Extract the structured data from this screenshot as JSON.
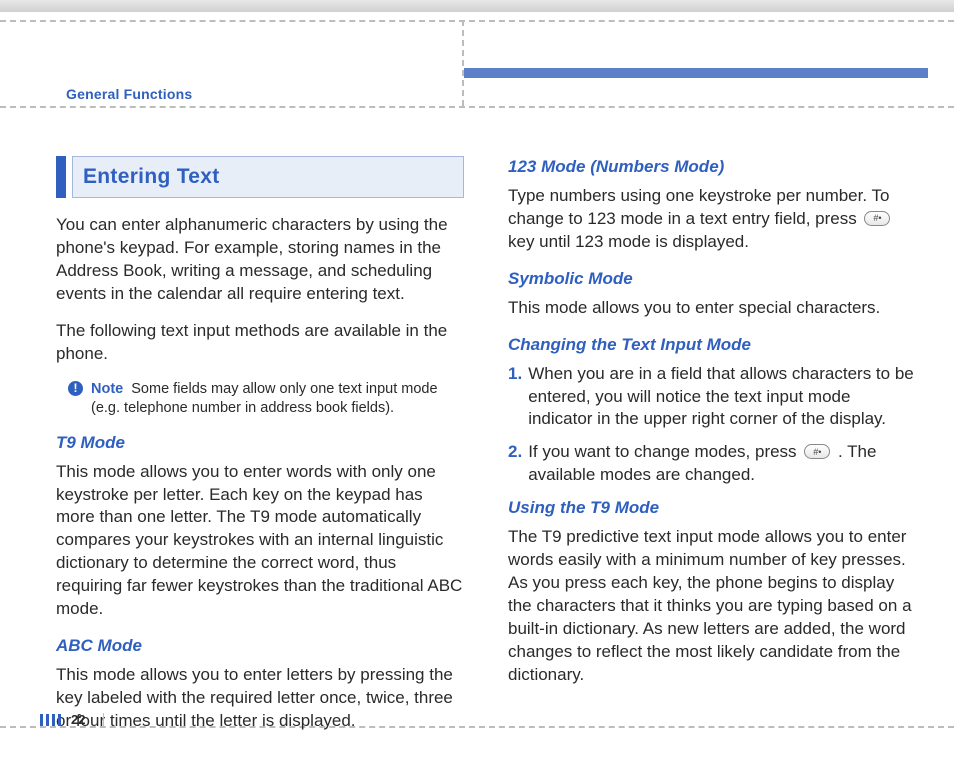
{
  "header": {
    "section_label": "General Functions"
  },
  "page": {
    "number": "22"
  },
  "left": {
    "heading": "Entering Text",
    "intro_p1": "You can enter alphanumeric characters by using the phone's keypad. For example, storing names in the Address Book, writing a message, and scheduling events in the calendar all require entering text.",
    "intro_p2": "The following text input methods are available in the phone.",
    "note_label": "Note",
    "note_text": "Some fields may allow only one text input mode (e.g. telephone number in address book fields).",
    "t9_title": "T9 Mode",
    "t9_body": "This mode allows you to enter words with only one keystroke per letter. Each key on the keypad has more than one letter. The T9 mode automatically compares your keystrokes with an internal linguistic dictionary to determine the correct word, thus requiring far fewer keystrokes than the traditional ABC mode.",
    "abc_title": "ABC Mode",
    "abc_body": "This mode allows you to enter letters by pressing the key labeled with the required letter once, twice, three or four times until the letter is displayed."
  },
  "right": {
    "m123_title": "123 Mode (Numbers Mode)",
    "m123_body_a": "Type numbers using one keystroke per number. To change to 123 mode in a text entry field, press ",
    "m123_body_b": " key until 123 mode is displayed.",
    "sym_title": "Symbolic Mode",
    "sym_body": "This mode allows you to enter special characters.",
    "chg_title": "Changing the Text Input Mode",
    "chg_item1_num": "1.",
    "chg_item1": "When you are in a field that allows characters to be entered, you will notice the text input mode indicator in the upper right corner of the display.",
    "chg_item2_num": "2.",
    "chg_item2_a": "If you want to change modes, press ",
    "chg_item2_b": " . The available modes are changed.",
    "use_title": "Using the T9 Mode",
    "use_body": "The T9 predictive text input mode allows you to enter words easily with a minimum number of key presses. As you press each key, the phone begins to display the characters that it thinks you are typing based on a built-in dictionary. As new letters are added, the word changes to reflect the most likely candidate from the dictionary.",
    "key_glyph": "#•"
  }
}
